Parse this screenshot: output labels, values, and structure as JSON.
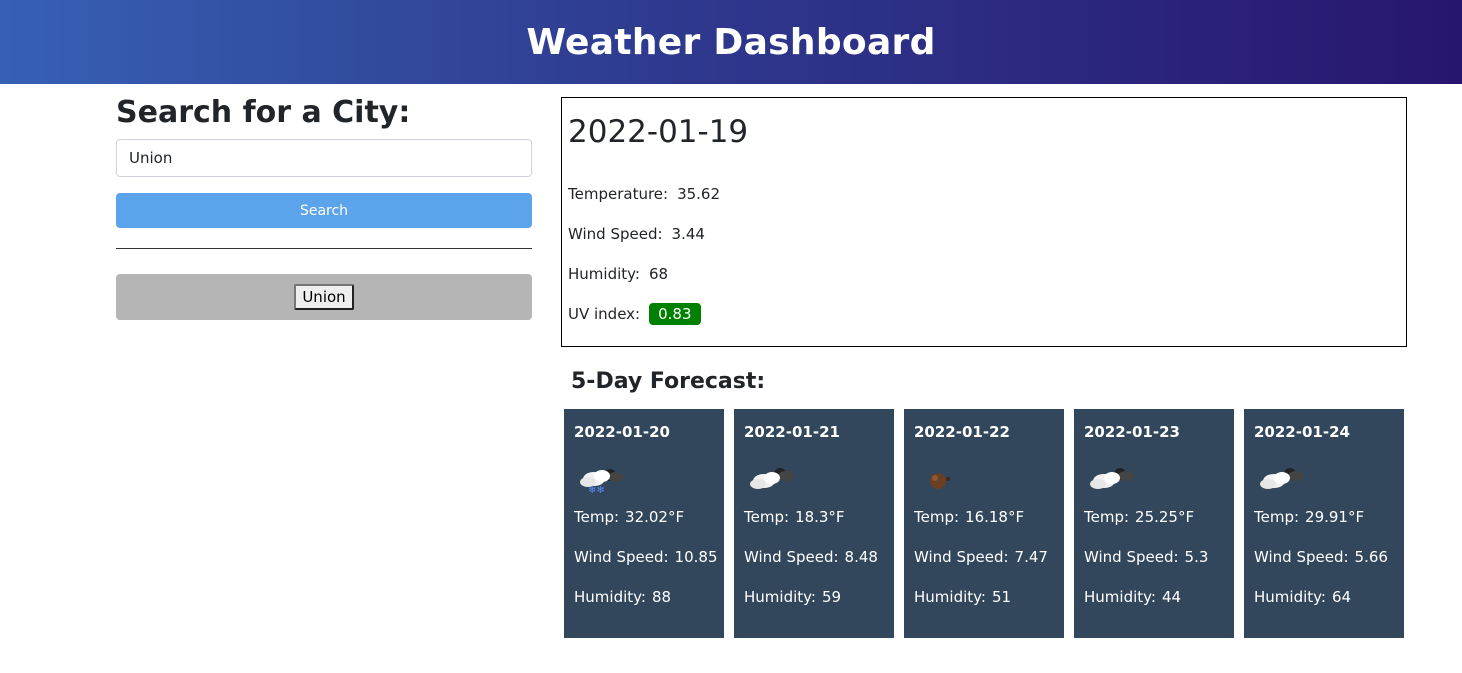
{
  "header": {
    "title": "Weather Dashboard"
  },
  "search": {
    "heading": "Search for a City:",
    "input_value": "Union",
    "button_label": "Search"
  },
  "history": [
    {
      "label": "Union"
    }
  ],
  "current": {
    "date": "2022-01-19",
    "temperature_label": "Temperature:",
    "temperature": "35.62",
    "wind_label": "Wind Speed:",
    "wind": "3.44",
    "humidity_label": "Humidity:",
    "humidity": "68",
    "uv_label": "UV index:",
    "uv": "0.83",
    "uv_color": "#008000"
  },
  "forecast": {
    "title": "5-Day Forecast:",
    "temp_label": "Temp:",
    "wind_label": "Wind Speed:",
    "humidity_label": "Humidity:",
    "days": [
      {
        "date": "2022-01-20",
        "icon": "snow-cloud-icon",
        "temp": "32.02°F",
        "wind": "10.85",
        "humidity": "88"
      },
      {
        "date": "2022-01-21",
        "icon": "partly-cloudy-icon",
        "temp": "18.3°F",
        "wind": "8.48",
        "humidity": "59"
      },
      {
        "date": "2022-01-22",
        "icon": "night-clear-icon",
        "temp": "16.18°F",
        "wind": "7.47",
        "humidity": "51"
      },
      {
        "date": "2022-01-23",
        "icon": "partly-cloudy-icon",
        "temp": "25.25°F",
        "wind": "5.3",
        "humidity": "44"
      },
      {
        "date": "2022-01-24",
        "icon": "partly-cloudy-icon",
        "temp": "29.91°F",
        "wind": "5.66",
        "humidity": "64"
      }
    ]
  }
}
